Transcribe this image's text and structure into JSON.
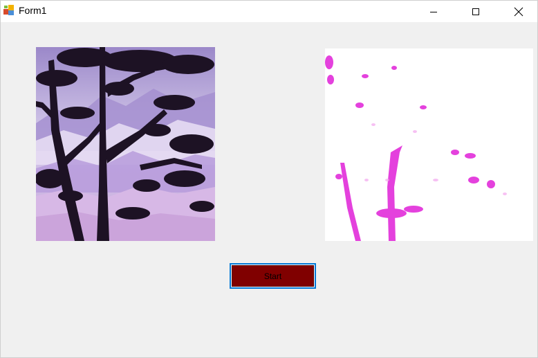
{
  "window": {
    "title": "Form1",
    "icon": "winforms-app-icon",
    "controls": {
      "minimize_icon": "minimize-icon",
      "maximize_icon": "maximize-icon",
      "close_icon": "close-icon"
    }
  },
  "pictures": {
    "original_image": "tree-silhouette-purple-mountains",
    "processed_image": "magenta-filtered-tree"
  },
  "start_button": {
    "label": "Start",
    "color": "#800000",
    "focus_border_color": "#0078d7"
  },
  "colors": {
    "form_background": "#f0f0f0",
    "titlebar_background": "#ffffff"
  }
}
